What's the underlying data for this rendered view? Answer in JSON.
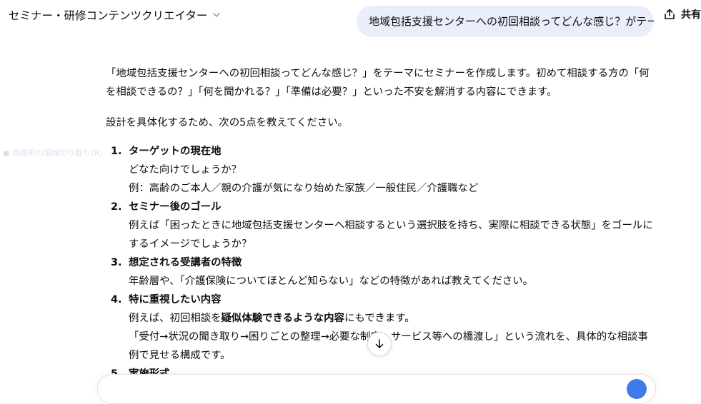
{
  "header": {
    "title": "セミナー・研修コンテンツクリエイター",
    "share_label": "共有"
  },
  "user_message": "地域包括支援センターへの初回相談ってどんな感じ？がテーマ",
  "faint_text": "● 四角形の領域切り取り(R)",
  "assistant": {
    "intro": "「地域包括支援センターへの初回相談ってどんな感じ？」をテーマにセミナーを作成します。初めて相談する方の「何を相談できるの？」「何を聞かれる？」「準備は必要？」といった不安を解消する内容にできます。",
    "ask": "設計を具体化するため、次の5点を教えてください。",
    "items": [
      {
        "num": "1.",
        "title": "ターゲットの現在地",
        "lines": [
          "どなた向けでしょうか？",
          "例：高齢のご本人／親の介護が気になり始めた家族／一般住民／介護職など"
        ]
      },
      {
        "num": "2.",
        "title": "セミナー後のゴール",
        "lines": [
          "例えば「困ったときに地域包括支援センターへ相談するという選択肢を持ち、実際に相談できる状態」をゴールにするイメージでしょうか？"
        ]
      },
      {
        "num": "3.",
        "title": "想定される受講者の特徴",
        "lines": [
          "年齢層や、「介護保険についてほとんど知らない」などの特徴があれば教えてください。"
        ]
      },
      {
        "num": "4.",
        "title": "特に重視したい内容",
        "line1_pre": "例えば、初回相談を",
        "line1_bold": "疑似体験できるような内容",
        "line1_post": "にもできます。",
        "line2": "「受付→状況の聞き取り→困りごとの整理→必要な制度・サービス等への橋渡し」という流れを、具体的な相談事例で見せる構成です。"
      },
      {
        "num": "5.",
        "title": "実施形式"
      }
    ]
  },
  "icons": {
    "title_chevron": "chevron-down-icon",
    "share": "share-icon",
    "scroll": "arrow-down-icon",
    "send": "send-icon"
  },
  "colors": {
    "user_bubble": "#e9eefa",
    "text": "#0d0d0d",
    "send_button": "#3f7ae8"
  }
}
